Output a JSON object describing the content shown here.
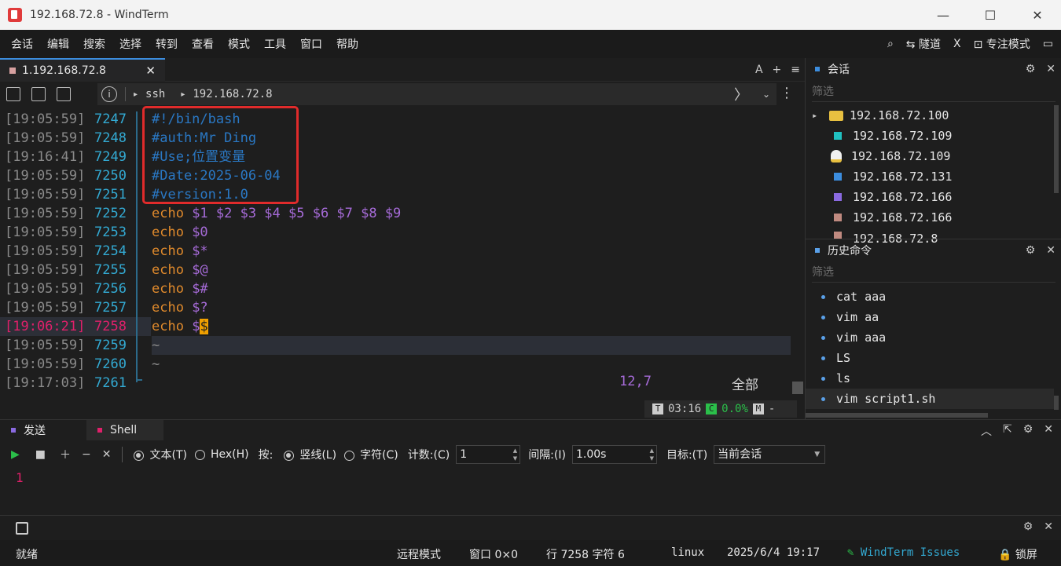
{
  "window": {
    "title": "192.168.72.8 - WindTerm",
    "minimize": "—",
    "maximize": "☐",
    "close": "✕"
  },
  "menu": {
    "items": [
      "会话",
      "编辑",
      "搜索",
      "选择",
      "转到",
      "查看",
      "模式",
      "工具",
      "窗口",
      "帮助"
    ],
    "right": {
      "search_icon": "⌕",
      "tunnel": "隧道",
      "x": "X",
      "focus": "专注模式",
      "layout_icon": "▭"
    }
  },
  "tab": {
    "label": "1.192.168.72.8",
    "close": "✕",
    "tools": [
      "A",
      "+",
      "≡"
    ]
  },
  "path": {
    "info": "i",
    "segments": [
      "ssh",
      "192.168.72.8"
    ]
  },
  "terminal": {
    "lines": [
      {
        "ts": "[19:05:59]",
        "ln": "7247",
        "parts": [
          {
            "t": "#!/bin/bash",
            "c": "c-comment"
          }
        ]
      },
      {
        "ts": "[19:05:59]",
        "ln": "7248",
        "parts": [
          {
            "t": "#auth:Mr Ding",
            "c": "c-comment"
          }
        ]
      },
      {
        "ts": "[19:16:41]",
        "ln": "7249",
        "parts": [
          {
            "t": "#Use;位置变量",
            "c": "c-comment"
          }
        ]
      },
      {
        "ts": "[19:05:59]",
        "ln": "7250",
        "parts": [
          {
            "t": "#Date:2025-06-04",
            "c": "c-comment"
          }
        ]
      },
      {
        "ts": "[19:05:59]",
        "ln": "7251",
        "parts": [
          {
            "t": "#version:1.0",
            "c": "c-comment"
          }
        ]
      },
      {
        "ts": "[19:05:59]",
        "ln": "7252",
        "parts": [
          {
            "t": "echo ",
            "c": "c-echo"
          },
          {
            "t": "$1 $2 $3 $4 $5 $6 $7 $8 $9",
            "c": "c-var"
          }
        ]
      },
      {
        "ts": "[19:05:59]",
        "ln": "7253",
        "parts": [
          {
            "t": "echo ",
            "c": "c-echo"
          },
          {
            "t": "$0",
            "c": "c-var"
          }
        ]
      },
      {
        "ts": "[19:05:59]",
        "ln": "7254",
        "parts": [
          {
            "t": "echo ",
            "c": "c-echo"
          },
          {
            "t": "$*",
            "c": "c-var"
          }
        ]
      },
      {
        "ts": "[19:05:59]",
        "ln": "7255",
        "parts": [
          {
            "t": "echo ",
            "c": "c-echo"
          },
          {
            "t": "$@",
            "c": "c-var"
          }
        ]
      },
      {
        "ts": "[19:05:59]",
        "ln": "7256",
        "parts": [
          {
            "t": "echo ",
            "c": "c-echo"
          },
          {
            "t": "$#",
            "c": "c-var"
          }
        ]
      },
      {
        "ts": "[19:05:59]",
        "ln": "7257",
        "parts": [
          {
            "t": "echo ",
            "c": "c-echo"
          },
          {
            "t": "$?",
            "c": "c-var"
          }
        ]
      },
      {
        "ts": "[19:06:21]",
        "ln": "7258",
        "active": true,
        "parts": [
          {
            "t": "echo ",
            "c": "c-echo"
          },
          {
            "t": "$",
            "c": "c-var"
          },
          {
            "t": "$",
            "c": "cursor"
          }
        ]
      },
      {
        "ts": "[19:05:59]",
        "ln": "7259",
        "hl": true,
        "parts": [
          {
            "t": "~",
            "c": "c-tilde"
          }
        ]
      },
      {
        "ts": "[19:05:59]",
        "ln": "7260",
        "parts": [
          {
            "t": "~",
            "c": "c-tilde"
          }
        ]
      },
      {
        "ts": "[19:17:03]",
        "ln": "7261",
        "parts": []
      }
    ],
    "vim_pos": "12,7",
    "vim_all": "全部",
    "status": {
      "t": "T",
      "time": "03:16",
      "c": "C",
      "pct": "0.0%",
      "m": "M",
      "dash": "-"
    }
  },
  "sessions": {
    "title": "会话",
    "filter": "筛选",
    "items": [
      {
        "label": "192.168.72.100",
        "color": "#e8c040",
        "icon": "folder-icon"
      },
      {
        "label": "192.168.72.109",
        "color": "#20c0c0",
        "icon": "square-icon"
      },
      {
        "label": "192.168.72.109",
        "color": "#f0f0f0",
        "icon": "linux-icon"
      },
      {
        "label": "192.168.72.131",
        "color": "#3c8dde",
        "icon": "square-icon"
      },
      {
        "label": "192.168.72.166",
        "color": "#8a6ae0",
        "icon": "square-icon"
      },
      {
        "label": "192.168.72.166",
        "color": "#c08a80",
        "icon": "square-icon"
      },
      {
        "label": "192.168.72.8",
        "color": "#c08a80",
        "icon": "square-icon"
      }
    ]
  },
  "history": {
    "title": "历史命令",
    "filter": "筛选",
    "items": [
      "cat aaa",
      "vim aa",
      "vim aaa",
      "LS",
      "ls",
      "vim script1.sh"
    ]
  },
  "send": {
    "tabs": [
      {
        "label": "发送",
        "color": "#8a6ae0"
      },
      {
        "label": "Shell",
        "color": "#e0206a"
      }
    ],
    "text_mode": "文本(T)",
    "hex_mode": "Hex(H)",
    "by": "按:",
    "line": "竖线(L)",
    "char": "字符(C)",
    "count_label": "计数:(C)",
    "count": "1",
    "interval_label": "间隔:(I)",
    "interval": "1.00s",
    "target_label": "目标:(T)",
    "target": "当前会话",
    "content": "1"
  },
  "statusbar": {
    "ready": "就绪",
    "remote": "远程模式",
    "window": "窗口 0×0",
    "pos": "行 7258 字符 6",
    "os": "linux",
    "datetime": "2025/6/4 19:17",
    "issues": "WindTerm Issues",
    "lock": "锁屏"
  }
}
